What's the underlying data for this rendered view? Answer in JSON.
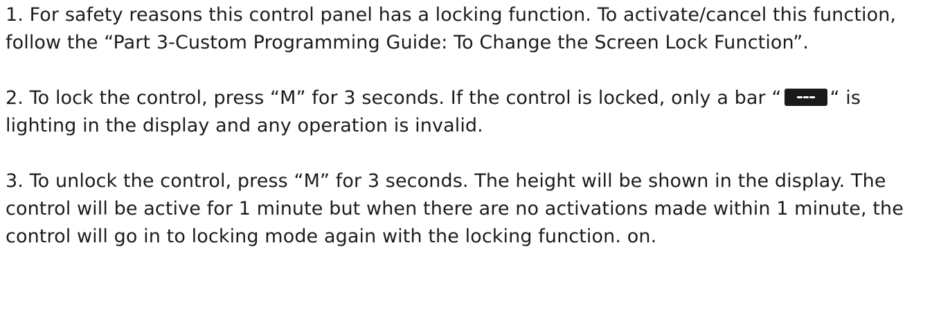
{
  "paragraphs": {
    "p1": "1. For safety reasons this control panel has a locking function. To activate/cancel this function, follow the “Part 3-Custom Programming Guide: To Change the Screen Lock Function”.",
    "p2_before": "2. To lock the control, press “M” for 3 seconds. If the control is locked, only a bar “",
    "p2_after": "“ is lighting in the display and any operation is invalid.",
    "p3": "3. To unlock the control, press “M” for 3 seconds. The height will be shown in the display. The control will be active for 1 minute but when there are no activations made within 1 minute, the control will go in to locking mode again with the locking function. on."
  },
  "icons": {
    "lock_bar": "dash-display-icon",
    "lock_bar_bg": "#1a1a1a",
    "lock_bar_fg": "#ffffff"
  }
}
